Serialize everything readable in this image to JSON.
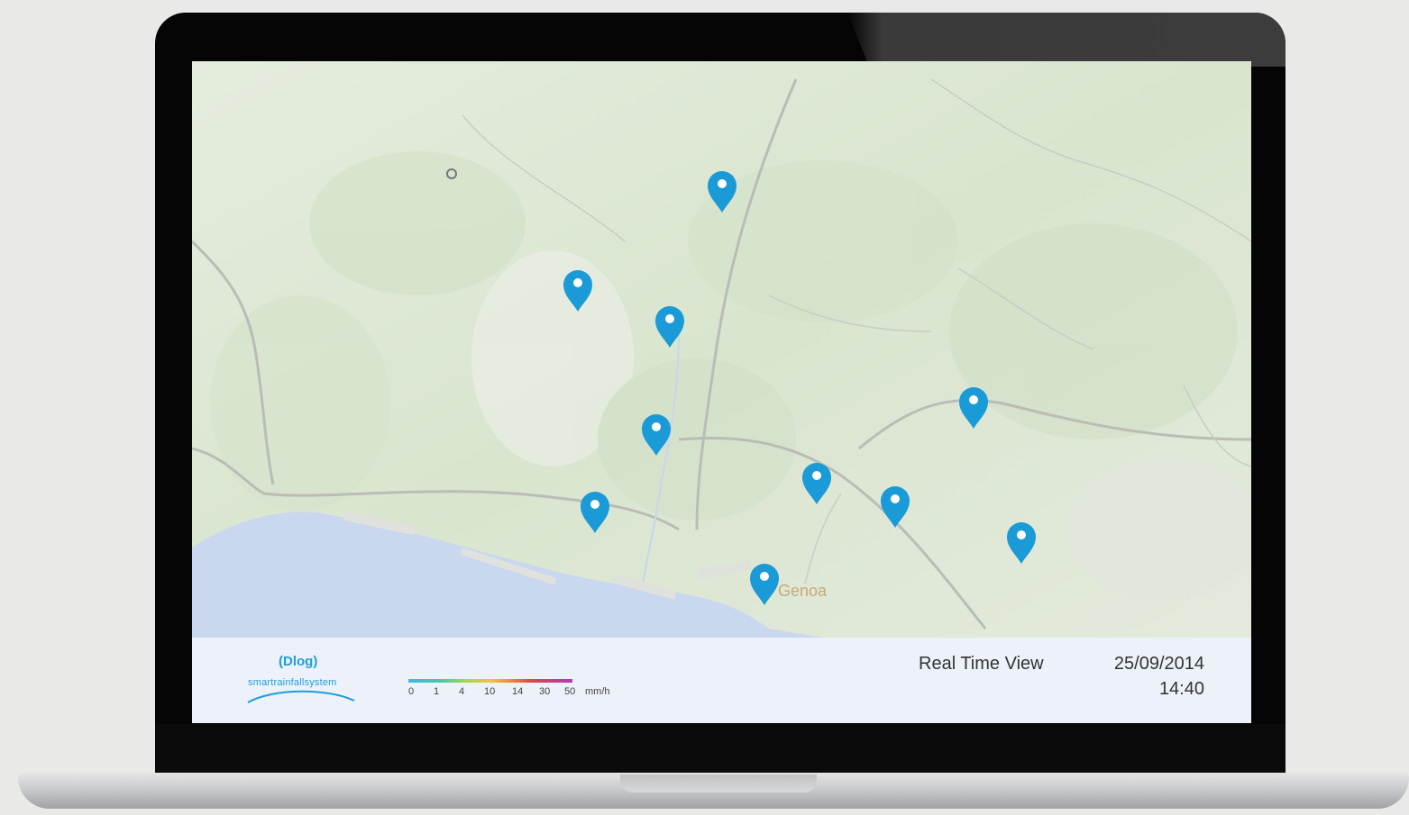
{
  "window": {
    "view_mode": "Real Time View",
    "date": "25/09/2014",
    "time": "14:40"
  },
  "brand": {
    "logo_mark": "(Dlog)",
    "logo_text": "smartrainfallsystem"
  },
  "legend": {
    "ticks": [
      "0",
      "1",
      "4",
      "10",
      "14",
      "30",
      "50"
    ],
    "unit": "mm/h"
  },
  "map": {
    "city_label": "Genoa",
    "marker_color": "#1a9bd7",
    "sea_color": "#c7d6ee",
    "land_color": "#dfe8d7",
    "markers": [
      {
        "id": "marker-1"
      },
      {
        "id": "marker-2"
      },
      {
        "id": "marker-3"
      },
      {
        "id": "marker-4"
      },
      {
        "id": "marker-5"
      },
      {
        "id": "marker-6"
      },
      {
        "id": "marker-7"
      },
      {
        "id": "marker-8"
      },
      {
        "id": "marker-9"
      },
      {
        "id": "marker-10"
      }
    ]
  }
}
